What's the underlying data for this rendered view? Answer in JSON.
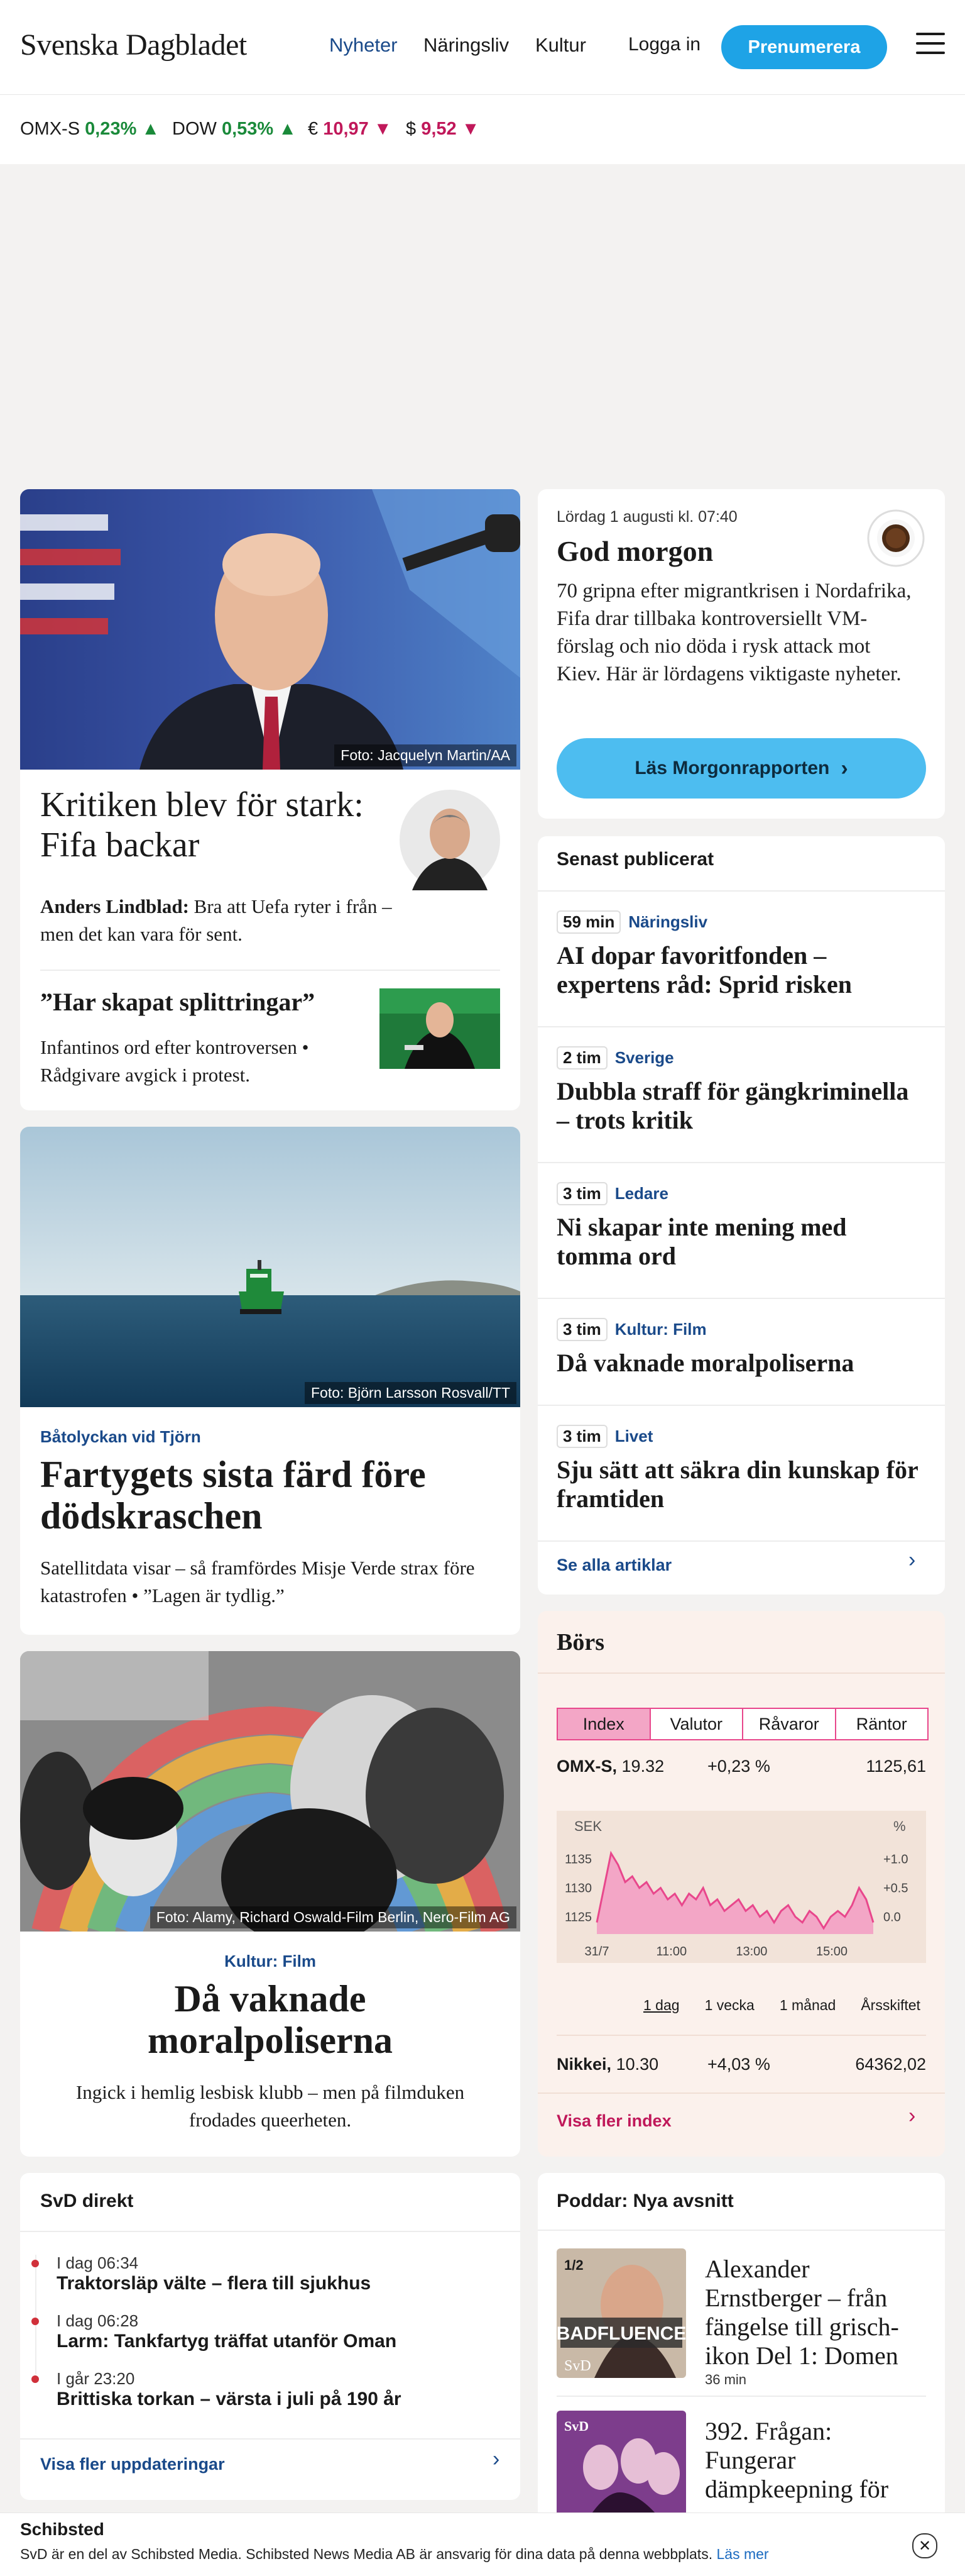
{
  "header": {
    "logo": "Svenska Dagbladet",
    "nav": [
      "Nyheter",
      "Näringsliv",
      "Kultur"
    ],
    "login": "Logga in",
    "subscribe": "Prenumerera"
  },
  "ticker": [
    {
      "label": "OMX-S",
      "value": "0,23%",
      "dir": "up"
    },
    {
      "label": "DOW",
      "value": "0,53%",
      "dir": "up"
    },
    {
      "label": "€",
      "value": "10,97",
      "dir": "down"
    },
    {
      "label": "$",
      "value": "9,52",
      "dir": "down"
    }
  ],
  "lead": {
    "photo_credit": "Foto: Jacquelyn Martin/AA",
    "headline": "Kritiken blev för stark: Fifa backar",
    "byline_name": "Anders Lindblad:",
    "byline_text": "Bra att Uefa ryter i från – men det kan vara för sent.",
    "sub_headline": "”Har skapat splittringar”",
    "sub_text": "Infantinos ord efter kontroversen • Rådgivare avgick i protest."
  },
  "morning": {
    "date": "Lördag 1 augusti kl. 07:40",
    "title": "God morgon",
    "text": "70 gripna efter migrantkrisen i Nordafrika, Fifa drar tillbaka kontroversiellt VM-förslag och nio döda i rysk attack mot Kiev. Här är lördagens viktigaste nyheter.",
    "button": "Läs Morgonrapporten"
  },
  "latest": {
    "title": "Senast publicerat",
    "items": [
      {
        "time": "59 min",
        "section": "Näringsliv",
        "headline": "AI dopar favoritfonden – expertens råd: Sprid risken"
      },
      {
        "time": "2 tim",
        "section": "Sverige",
        "headline": "Dubbla straff för gängkriminella – trots kritik"
      },
      {
        "time": "3 tim",
        "section": "Ledare",
        "headline": "Ni skapar inte mening med tomma ord"
      },
      {
        "time": "3 tim",
        "section": "Kultur: Film",
        "headline": "Då vaknade moralpoliserna"
      },
      {
        "time": "3 tim",
        "section": "Livet",
        "headline": "Sju sätt att säkra din kunskap för framtiden"
      }
    ],
    "more": "Se alla artiklar"
  },
  "ship": {
    "photo_credit": "Foto: Björn Larsson Rosvall/TT",
    "kicker": "Båtolyckan vid Tjörn",
    "headline": "Fartygets sista färd före dödskraschen",
    "text": "Satellitdata visar – så framfördes Misje Verde strax före katastrofen • ”Lagen är tydlig.”"
  },
  "film": {
    "photo_credit": "Foto: Alamy, Richard Oswald-Film Berlin, Nero-Film AG",
    "kicker": "Kultur: Film",
    "headline": "Då vaknade moralpoliserna",
    "text": "Ingick i hemlig lesbisk klubb – men på filmduken frodades queerheten."
  },
  "bors": {
    "title": "Börs",
    "tabs": [
      "Index",
      "Valutor",
      "Råvaror",
      "Räntor"
    ],
    "index_name": "OMX-S,",
    "index_value": "19.32",
    "index_change": "+0,23 %",
    "index_level": "1125,61",
    "periods": [
      "1 dag",
      "1 vecka",
      "1 månad",
      "Årsskiftet"
    ],
    "second_name": "Nikkei,",
    "second_value": "10.30",
    "second_change": "+4,03 %",
    "second_level": "64362,02",
    "more": "Visa fler index",
    "accent": "#e8478c"
  },
  "chart_data": {
    "type": "area",
    "ylabel": "SEK",
    "y2label": "%",
    "y_ticks": [
      "1135",
      "1130",
      "1125"
    ],
    "y2_ticks": [
      "+1.0",
      "+0.5",
      "0.0"
    ],
    "x_ticks": [
      "31/7",
      "11:00",
      "13:00",
      "15:00"
    ],
    "ylim": [
      1122,
      1139
    ],
    "values": [
      1124,
      1130,
      1136,
      1134,
      1131,
      1132,
      1130,
      1131,
      1129,
      1130,
      1128,
      1129,
      1127,
      1129,
      1128,
      1130,
      1127,
      1128,
      1126,
      1127,
      1128,
      1126,
      1127,
      1125,
      1126,
      1124,
      1126,
      1127,
      1125,
      1124,
      1126,
      1125,
      1123,
      1125,
      1126,
      1125,
      1127,
      1130,
      1128,
      1124
    ]
  },
  "direkt": {
    "title": "SvD direkt",
    "items": [
      {
        "time": "I dag 06:34",
        "headline": "Traktorsläp välte – flera till sjukhus"
      },
      {
        "time": "I dag 06:28",
        "headline": "Larm: Tankfartyg träffat utanför Oman"
      },
      {
        "time": "I går 23:20",
        "headline": "Brittiska torkan – värsta i juli på 190 år"
      }
    ],
    "more": "Visa fler uppdateringar"
  },
  "poddar": {
    "title": "Poddar: Nya avsnitt",
    "items": [
      {
        "badge": "1/2",
        "cover": "BADFLUENCE",
        "brand": "SvD",
        "title": "Alexander Ernstberger – från fängelse till grisch-ikon Del 1: Domen",
        "duration": "36 min"
      },
      {
        "badge": "SvD",
        "cover": "",
        "brand": "",
        "title": "392. Frågan: Fungerar dämpkeepning för",
        "duration": ""
      }
    ]
  },
  "footer": {
    "brand": "Schibsted",
    "text": "SvD är en del av Schibsted Media. Schibsted News Media AB är ansvarig för dina data på denna webbplats.",
    "link": "Läs mer"
  }
}
